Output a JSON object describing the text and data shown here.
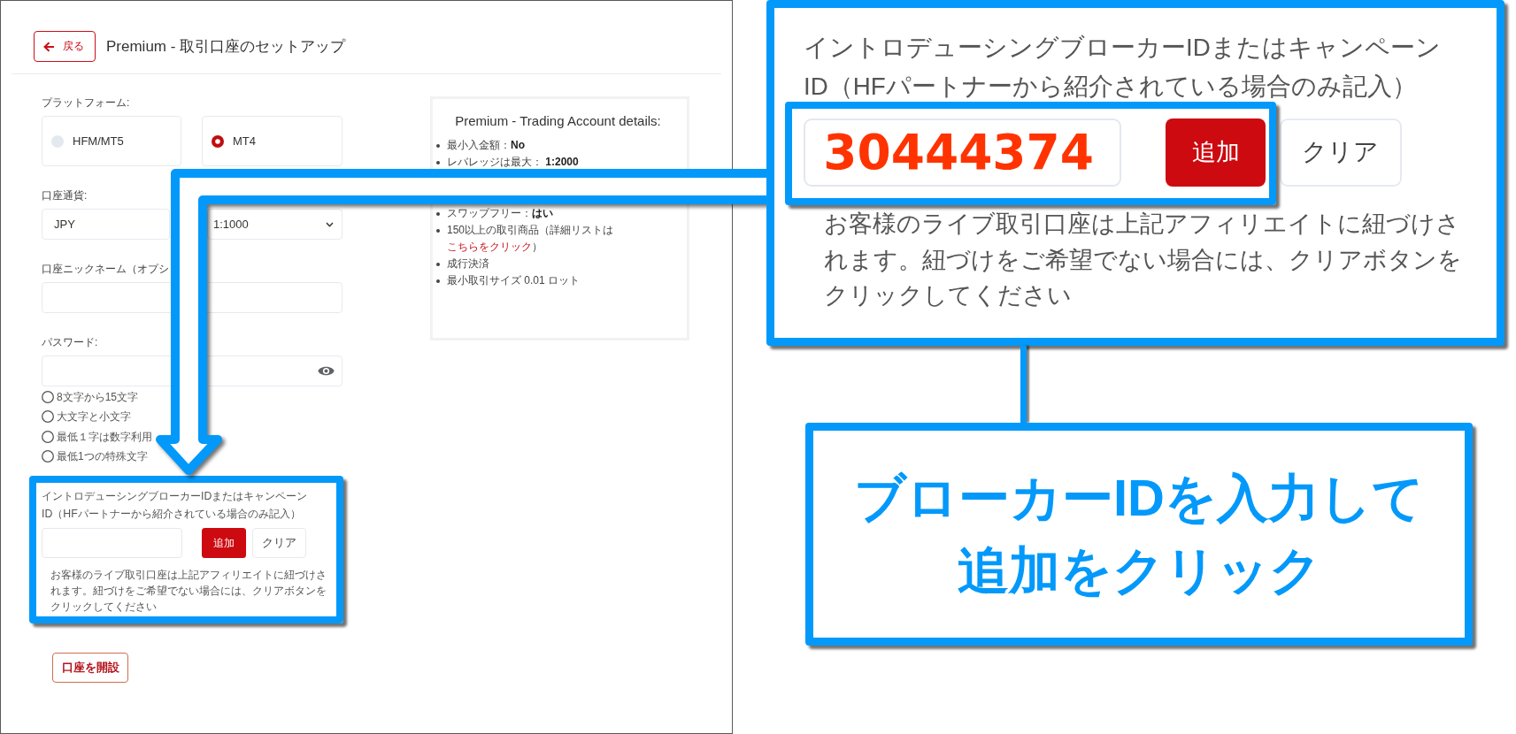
{
  "header": {
    "back_button": "戻る",
    "title": "Premium - 取引口座のセットアップ"
  },
  "form": {
    "platform": {
      "label": "プラットフォーム:",
      "options": [
        {
          "label": "HFM/MT5",
          "selected": false
        },
        {
          "label": "MT4",
          "selected": true
        }
      ]
    },
    "currency": {
      "label": "口座通貨:",
      "value": "JPY"
    },
    "leverage": {
      "value": "1:1000"
    },
    "nickname": {
      "label": "口座ニックネーム（オプシ"
    },
    "password": {
      "label": "パスワード:",
      "requirements": [
        {
          "text": "8文字から15文字",
          "met": false
        },
        {
          "text": "大文字と小文字",
          "met": false
        },
        {
          "text": "最低１字は数字利用",
          "met": false
        },
        {
          "text": "最低1つの特殊文字",
          "met": false
        }
      ]
    },
    "broker_id": {
      "label": "イントロデューシングブローカーIDまたはキャンペーンID（HFパートナーから紹介されている場合のみ記入）",
      "add_button": "追加",
      "clear_button": "クリア",
      "notice": "お客様のライブ取引口座は上記アフィリエイトに紐づけされます。紐づけをご希望でない場合には、クリアボタンをクリックしてください"
    },
    "submit_button": "口座を開設"
  },
  "details": {
    "title": "Premium - Trading Account details:",
    "items": [
      {
        "text": "最小入金額：**No**"
      },
      {
        "text": "レバレッジは最大： **1:2000**"
      },
      {
        "text": "スワップフリー：**はい**"
      },
      {
        "text": "150以上の取引商品（詳細リストは",
        "link": "こちらをクリック",
        "after": "）"
      },
      {
        "text": "成行決済"
      },
      {
        "text": "最小取引サイズ 0.01 ロット"
      }
    ]
  },
  "callout": {
    "label": "イントロデューシングブローカーIDまたはキャンペーンID（HFパートナーから紹介されている場合のみ記入）",
    "value": "30444374",
    "add_button": "追加",
    "clear_button": "クリア",
    "notice": "お客様のライブ取引口座は上記アフィリエイトに紐づけされます。紐づけをご希望でない場合には、クリアボタンをクリックしてください"
  },
  "instruction": "ブローカーIDを入力して追加をクリック"
}
